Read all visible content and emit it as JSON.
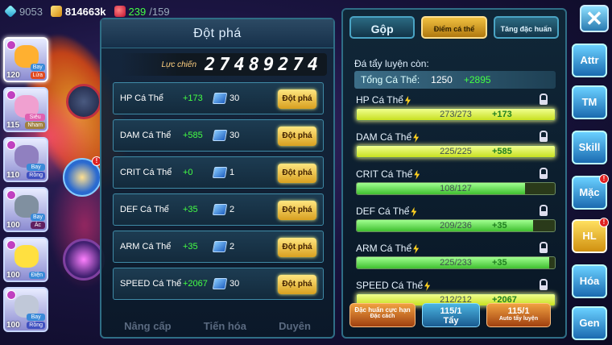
{
  "topbar": {
    "diamond": "9053",
    "gold": "814663k",
    "stamina_current": "239",
    "stamina_max": "/159"
  },
  "team": [
    {
      "level": "120",
      "tags": [
        "Bay",
        "Lửa"
      ],
      "color": "#ffb030"
    },
    {
      "level": "115",
      "tags": [
        "Siêu",
        "Nham"
      ],
      "color": "#f0a0d0"
    },
    {
      "level": "110",
      "tags": [
        "Bay",
        "Rồng"
      ],
      "color": "#9080c0"
    },
    {
      "level": "100",
      "tags": [
        "Bay",
        "Ác"
      ],
      "color": "#8090a0"
    },
    {
      "level": "100",
      "tags": [
        "Điện"
      ],
      "color": "#ffe040"
    },
    {
      "level": "100",
      "tags": [
        "Bay",
        "Rồng"
      ],
      "color": "#c0c8d8"
    }
  ],
  "breakthrough": {
    "title": "Đột phá",
    "power_label": "Lực chiến",
    "power_value": "27489274",
    "button_label": "Đột phá",
    "rows": [
      {
        "name": "HP Cá Thể",
        "inc": "+173",
        "count": "30"
      },
      {
        "name": "DAM Cá Thể",
        "inc": "+585",
        "count": "30"
      },
      {
        "name": "CRIT Cá Thể",
        "inc": "+0",
        "count": "1"
      },
      {
        "name": "DEF Cá Thể",
        "inc": "+35",
        "count": "2"
      },
      {
        "name": "ARM Cá Thể",
        "inc": "+35",
        "count": "2"
      },
      {
        "name": "SPEED Cá Thể",
        "inc": "+2067",
        "count": "30"
      }
    ],
    "footer": [
      "Nâng cấp",
      "Tiến hóa",
      "Duyên"
    ]
  },
  "training": {
    "tabs": [
      "Gộp",
      "Điểm cá thể",
      "Tăng đặc huấn"
    ],
    "subtitle": "Đá tẩy luyện còn:",
    "total_label": "Tổng Cá Thể:",
    "total_value": "1250",
    "total_add": "+2895",
    "stats": [
      {
        "name": "HP Cá Thể",
        "value": "273/273",
        "add": "+173",
        "ratio": 1.0
      },
      {
        "name": "DAM Cá Thể",
        "value": "225/225",
        "add": "+585",
        "ratio": 1.0
      },
      {
        "name": "CRIT Cá Thể",
        "value": "108/127",
        "add": "",
        "ratio": 0.85
      },
      {
        "name": "DEF Cá Thể",
        "value": "209/236",
        "add": "+35",
        "ratio": 0.89
      },
      {
        "name": "ARM Cá Thể",
        "value": "225/233",
        "add": "+35",
        "ratio": 0.97
      },
      {
        "name": "SPEED Cá Thể",
        "value": "212/212",
        "add": "+2067",
        "ratio": 1.0
      }
    ],
    "btn_special_label": "Đặc huấn cực hạn",
    "btn_special_sub": "Đặc cách",
    "btn_wash_count": "115/1",
    "btn_wash_label": "Tẩy",
    "btn_auto_count": "115/1",
    "btn_auto_label": "Auto tẩy luyện"
  },
  "menu": {
    "close": "✕",
    "items": [
      "Attr",
      "TM",
      "Skill",
      "Mặc",
      "HL",
      "Hóa",
      "Gen"
    ]
  }
}
